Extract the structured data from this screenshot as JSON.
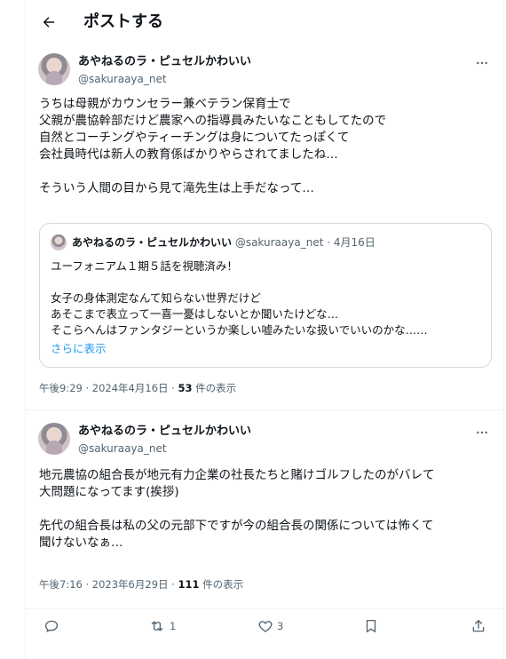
{
  "header": {
    "title": "ポストする"
  },
  "post1": {
    "name": "あやねるのラ・ピュセルかわいい",
    "handle": "@sakuraaya_net",
    "text": "うちは母親がカウンセラー兼ベテラン保育士で\n父親が農協幹部だけど農家への指導員みたいなこともしてたので\n自然とコーチングやティーチングは身についてたっぽくて\n会社員時代は新人の教育係ばかりやらされてましたね…\n\nそういう人間の目から見て滝先生は上手だなって…",
    "meta_time": "午後9:29 · 2024年4月16日 · ",
    "views_count": "53",
    "views_label": " 件の表示",
    "quote": {
      "name": "あやねるのラ・ピュセルかわいい",
      "handle_date": " @sakuraaya_net · 4月16日",
      "text": "ユーフォニアム１期５話を視聴済み！\n\n女子の身体測定なんて知らない世界だけど\nあそこまで表立って一喜一憂はしないとか聞いたけどな…\nそこらへんはファンタジーというか楽しい嘘みたいな扱いでいいのかな……",
      "more": "さらに表示"
    }
  },
  "post2": {
    "name": "あやねるのラ・ピュセルかわいい",
    "handle": "@sakuraaya_net",
    "text": "地元農協の組合長が地元有力企業の社長たちと賭けゴルフしたのがバレて\n大問題になってます(挨拶)\n\n先代の組合長は私の父の元部下ですが今の組合長の関係については怖くて\n聞けないなぁ…",
    "meta_time": "午後7:16 · 2023年6月29日 · ",
    "views_count": "111",
    "views_label": " 件の表示"
  },
  "actions": {
    "reply_count": "",
    "repost_count": "1",
    "like_count": "3"
  }
}
